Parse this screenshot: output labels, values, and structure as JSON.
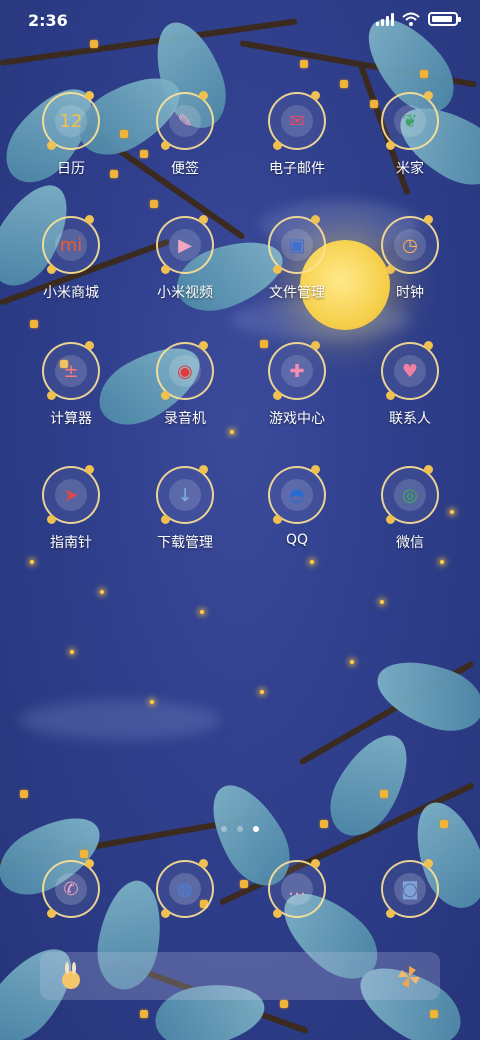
{
  "status": {
    "time": "2:36",
    "battery_percent": 90
  },
  "apps": [
    {
      "id": "calendar",
      "label": "日历",
      "icon": "calendar-icon",
      "glyph": "12"
    },
    {
      "id": "notes",
      "label": "便签",
      "icon": "notes-icon",
      "glyph": "✎"
    },
    {
      "id": "email",
      "label": "电子邮件",
      "icon": "mail-icon",
      "glyph": "✉"
    },
    {
      "id": "mihome",
      "label": "米家",
      "icon": "mihome-icon",
      "glyph": "❦"
    },
    {
      "id": "mistore",
      "label": "小米商城",
      "icon": "mi-store-icon",
      "glyph": "mi"
    },
    {
      "id": "mivideo",
      "label": "小米视频",
      "icon": "video-play-icon",
      "glyph": "▶"
    },
    {
      "id": "files",
      "label": "文件管理",
      "icon": "folder-icon",
      "glyph": "▣"
    },
    {
      "id": "clock",
      "label": "时钟",
      "icon": "clock-icon",
      "glyph": "◷"
    },
    {
      "id": "calculator",
      "label": "计算器",
      "icon": "calculator-icon",
      "glyph": "±"
    },
    {
      "id": "recorder",
      "label": "录音机",
      "icon": "recorder-icon",
      "glyph": "◉"
    },
    {
      "id": "games",
      "label": "游戏中心",
      "icon": "gamepad-icon",
      "glyph": "✚"
    },
    {
      "id": "contacts",
      "label": "联系人",
      "icon": "contacts-bunny-icon",
      "glyph": "♥"
    },
    {
      "id": "compass",
      "label": "指南针",
      "icon": "compass-icon",
      "glyph": "➤"
    },
    {
      "id": "downloads",
      "label": "下载管理",
      "icon": "download-icon",
      "glyph": "↓"
    },
    {
      "id": "qq",
      "label": "QQ",
      "icon": "qq-penguin-icon",
      "glyph": "◓"
    },
    {
      "id": "wechat",
      "label": "微信",
      "icon": "wechat-icon",
      "glyph": "◎"
    }
  ],
  "dock": [
    {
      "id": "phone",
      "icon": "phone-icon",
      "glyph": "✆"
    },
    {
      "id": "browser",
      "icon": "browser-planet-icon",
      "glyph": "◍"
    },
    {
      "id": "messages",
      "icon": "messages-icon",
      "glyph": "…"
    },
    {
      "id": "camera",
      "icon": "camera-icon",
      "glyph": "◙"
    }
  ],
  "pages": {
    "count": 3,
    "current": 3
  },
  "colors": {
    "accent_ring": "#ffe296",
    "background": "#2f3f8c",
    "moon": "#f6d14e"
  }
}
